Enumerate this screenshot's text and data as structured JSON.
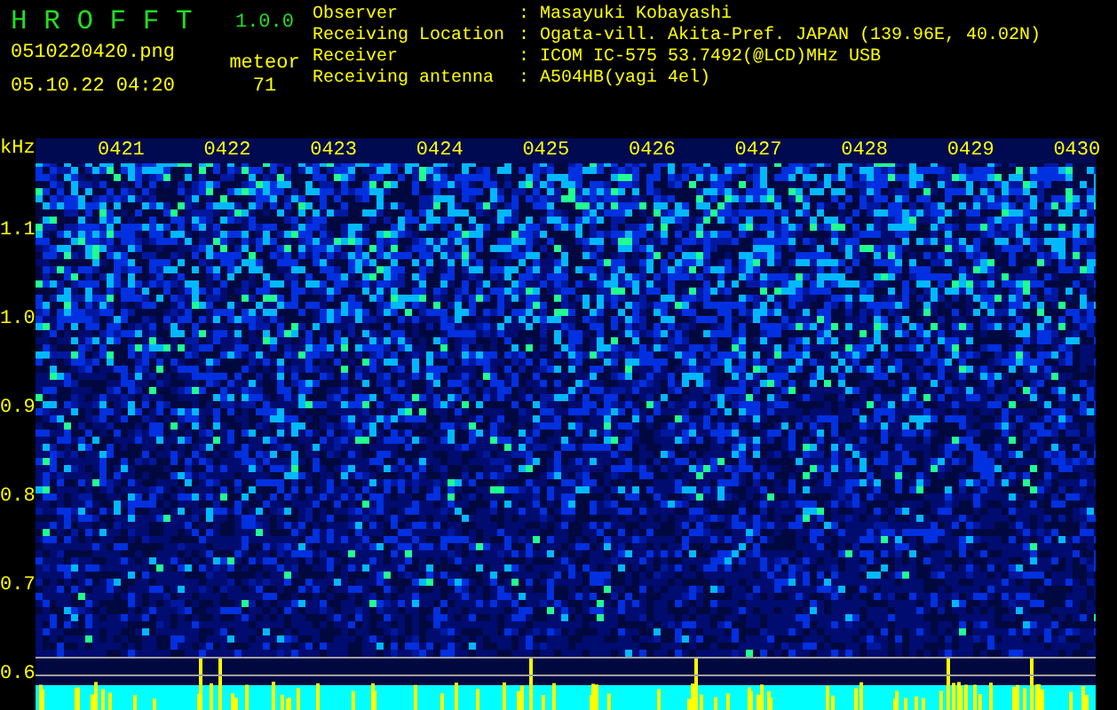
{
  "app": {
    "name": "H R O F F T",
    "version": "1.0.0"
  },
  "file": "0510220420.png",
  "timestamp": "05.10.22 04:20",
  "meteor": {
    "label": "meteor",
    "count": "71"
  },
  "info": [
    {
      "label": "Observer",
      "separator": ":",
      "value": "Masayuki Kobayashi"
    },
    {
      "label": "Receiving Location",
      "separator": ":",
      "value": "Ogata-vill. Akita-Pref. JAPAN (139.96E, 40.02N)"
    },
    {
      "label": "Receiver",
      "separator": ":",
      "value": "ICOM IC-575 53.7492(@LCD)MHz USB"
    },
    {
      "label": "Receiving antenna",
      "separator": ":",
      "value": "A504HB(yagi 4el)"
    }
  ],
  "axis": {
    "unit": "kHz",
    "yticks": [
      "1.1",
      "1.0",
      "0.9",
      "0.8",
      "0.7",
      "0.6"
    ]
  },
  "time_labels": [
    "0421",
    "0422",
    "0423",
    "0424",
    "0425",
    "0426",
    "0427",
    "0428",
    "0429",
    "0430"
  ]
}
